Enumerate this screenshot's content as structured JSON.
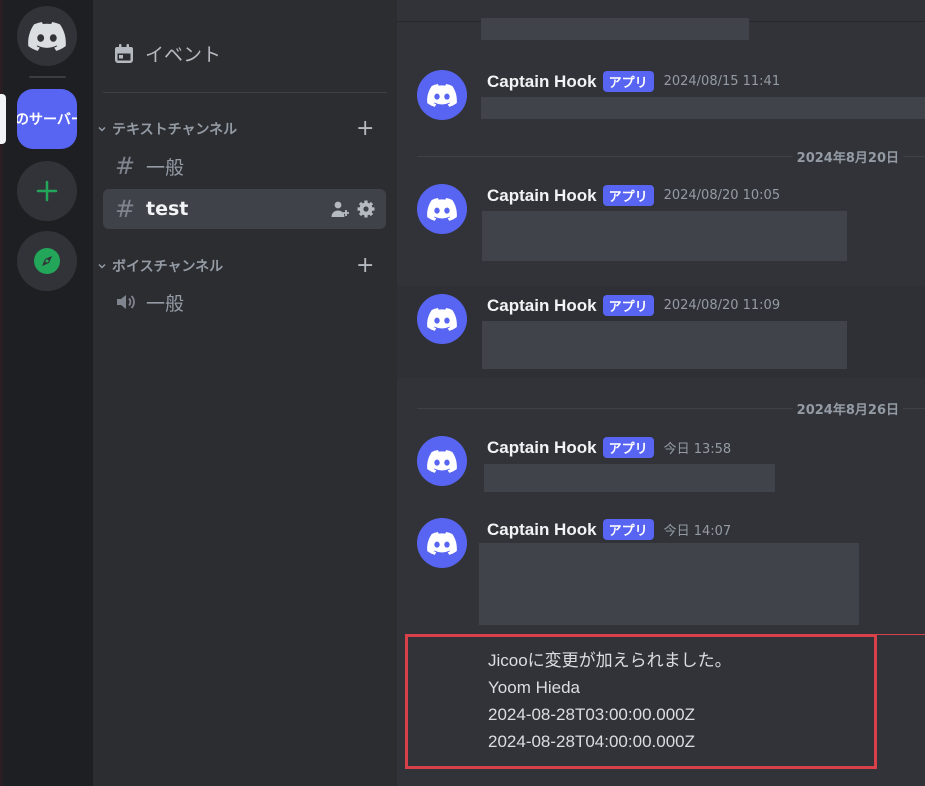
{
  "servers": {
    "current_server_name": "のサーバー"
  },
  "sidebar": {
    "events_label": "イベント",
    "categories": [
      {
        "label": "テキストチャンネル"
      },
      {
        "label": "ボイスチャンネル"
      }
    ],
    "text_channels": [
      {
        "name": "一般"
      },
      {
        "name": "test"
      }
    ],
    "voice_channels": [
      {
        "name": "一般"
      }
    ]
  },
  "chat": {
    "date_dividers": [
      "2024年8月20日",
      "2024年8月26日"
    ],
    "messages": [
      {
        "author": "Captain Hook",
        "tag": "アプリ",
        "timestamp": "2024/08/15 11:41"
      },
      {
        "author": "Captain Hook",
        "tag": "アプリ",
        "timestamp": "2024/08/20 10:05"
      },
      {
        "author": "Captain Hook",
        "tag": "アプリ",
        "timestamp": "2024/08/20 11:09"
      },
      {
        "author": "Captain Hook",
        "tag": "アプリ",
        "timestamp": "今日 13:58"
      },
      {
        "author": "Captain Hook",
        "tag": "アプリ",
        "timestamp": "今日 14:07"
      }
    ],
    "latest_message_lines": [
      "Jicooに変更が加えられました。",
      "Yoom Hieda",
      "2024-08-28T03:00:00.000Z",
      "2024-08-28T04:00:00.000Z"
    ]
  },
  "colors": {
    "brand": "#5865f2",
    "highlight_border": "#d9414a",
    "explore_green": "#23a55a"
  }
}
